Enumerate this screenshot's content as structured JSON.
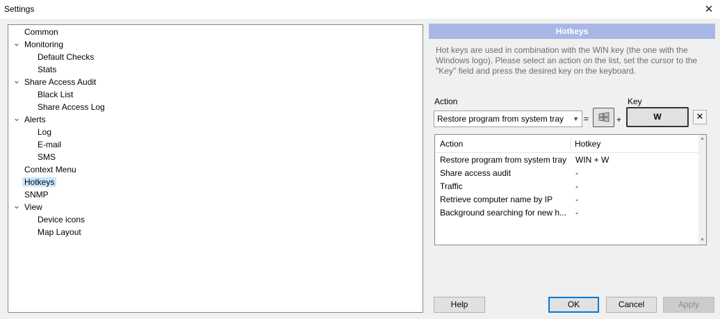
{
  "window": {
    "title": "Settings"
  },
  "tree": {
    "items": [
      {
        "label": "Common",
        "level": 0,
        "expandable": false
      },
      {
        "label": "Monitoring",
        "level": 0,
        "expandable": true
      },
      {
        "label": "Default Checks",
        "level": 1,
        "expandable": false
      },
      {
        "label": "Stats",
        "level": 1,
        "expandable": false
      },
      {
        "label": "Share Access Audit",
        "level": 0,
        "expandable": true
      },
      {
        "label": "Black List",
        "level": 1,
        "expandable": false
      },
      {
        "label": "Share Access Log",
        "level": 1,
        "expandable": false
      },
      {
        "label": "Alerts",
        "level": 0,
        "expandable": true
      },
      {
        "label": "Log",
        "level": 1,
        "expandable": false
      },
      {
        "label": "E-mail",
        "level": 1,
        "expandable": false
      },
      {
        "label": "SMS",
        "level": 1,
        "expandable": false
      },
      {
        "label": "Context Menu",
        "level": 0,
        "expandable": false
      },
      {
        "label": "Hotkeys",
        "level": 0,
        "expandable": false,
        "selected": true
      },
      {
        "label": "SNMP",
        "level": 0,
        "expandable": false
      },
      {
        "label": "View",
        "level": 0,
        "expandable": true
      },
      {
        "label": "Device icons",
        "level": 1,
        "expandable": false
      },
      {
        "label": "Map Layout",
        "level": 1,
        "expandable": false
      }
    ]
  },
  "panel": {
    "header": "Hotkeys",
    "description": "Hot keys are used in combination with the WIN key (the one with the Windows logo). Please select an action on the list, set the cursor to the \"Key\" field and press the desired key on the keyboard.",
    "action_label": "Action",
    "key_label": "Key",
    "action_selected": "Restore program from system tray",
    "equals": "=",
    "plus": "+",
    "key_value": "W",
    "clear_button": "✕"
  },
  "hotkey_list": {
    "columns": [
      "Action",
      "Hotkey"
    ],
    "rows": [
      {
        "action": "Restore program from system tray",
        "hotkey": "WIN + W"
      },
      {
        "action": "Share access audit",
        "hotkey": "-"
      },
      {
        "action": "Traffic",
        "hotkey": "-"
      },
      {
        "action": "Retrieve computer name by IP",
        "hotkey": "-"
      },
      {
        "action": "Background searching for new h...",
        "hotkey": "-"
      }
    ]
  },
  "buttons": {
    "help": "Help",
    "ok": "OK",
    "cancel": "Cancel",
    "apply": "Apply"
  },
  "icons": {
    "close": "close-icon",
    "windows_key": "windows-logo-icon",
    "expand": "chevron-down-icon"
  },
  "colors": {
    "header_bg": "#a9b7e6",
    "selection_bg": "#cce8ff",
    "default_button_border": "#0078d7"
  }
}
